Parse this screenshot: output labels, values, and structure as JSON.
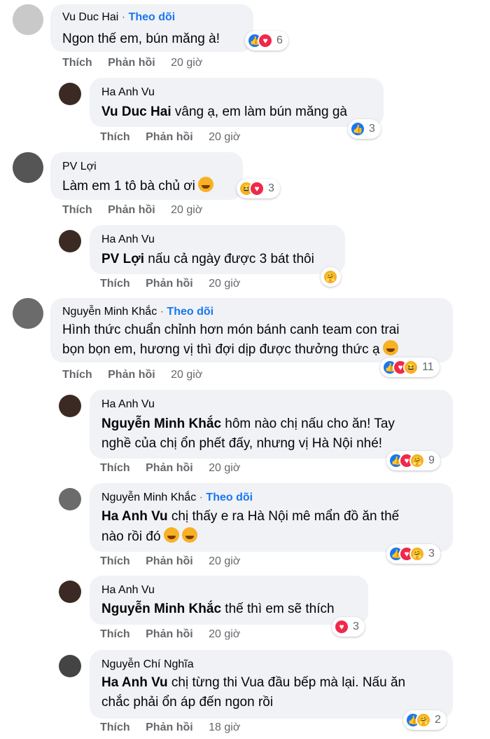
{
  "comments": [
    {
      "name": "Vu Duc Hai",
      "follow": "Theo dõi",
      "text": "Ngon thế em, bún măng à!",
      "actions": {
        "like": "Thích",
        "reply": "Phản hồi",
        "time": "20 giờ"
      },
      "reactions": {
        "icons": [
          "like-icon",
          "love-icon"
        ],
        "count": "6"
      }
    },
    {
      "name": "Ha Anh Vu",
      "mention": "Vu Duc Hai",
      "text": " vâng ạ, em làm bún măng gà",
      "actions": {
        "like": "Thích",
        "reply": "Phản hồi",
        "time": "20 giờ"
      },
      "reactions": {
        "icons": [
          "like-icon"
        ],
        "count": "3"
      }
    },
    {
      "name": "PV Lợi",
      "text": "Làm em 1 tô bà chủ ơi",
      "actions": {
        "like": "Thích",
        "reply": "Phản hồi",
        "time": "20 giờ"
      },
      "reactions": {
        "icons": [
          "haha-icon",
          "love-icon"
        ],
        "count": "3"
      }
    },
    {
      "name": "Ha Anh Vu",
      "mention": "PV Lợi",
      "text": " nấu cả ngày được 3 bát thôi",
      "actions": {
        "like": "Thích",
        "reply": "Phản hồi",
        "time": "20 giờ"
      },
      "reactions": {
        "icons": [
          "care-icon"
        ],
        "count": ""
      }
    },
    {
      "name": "Nguyễn Minh Khắc",
      "follow": "Theo dõi",
      "text_lines": [
        "Hình thức chuẩn chỉnh hơn món bánh canh team con trai",
        "bọn bọn em, hương vị thì đợi dịp được thưởng thức ạ"
      ],
      "actions": {
        "like": "Thích",
        "reply": "Phản hồi",
        "time": "20 giờ"
      },
      "reactions": {
        "icons": [
          "like-icon",
          "love-icon",
          "haha-icon"
        ],
        "count": "11"
      }
    },
    {
      "name": "Ha Anh Vu",
      "mention": "Nguyễn Minh Khắc",
      "text_lines": [
        " hôm nào chị nấu cho ăn! Tay",
        "nghề của chị ổn phết đấy, nhưng vị Hà Nội nhé!"
      ],
      "actions": {
        "like": "Thích",
        "reply": "Phản hồi",
        "time": "20 giờ"
      },
      "reactions": {
        "icons": [
          "like-icon",
          "love-icon",
          "care-icon"
        ],
        "count": "9"
      }
    },
    {
      "name": "Nguyễn Minh Khắc",
      "follow": "Theo dõi",
      "mention": "Ha Anh Vu",
      "text_lines": [
        " chị thấy e ra Hà Nội mê mẩn đồ ăn thế",
        "nào rồi đó"
      ],
      "actions": {
        "like": "Thích",
        "reply": "Phản hồi",
        "time": "20 giờ"
      },
      "reactions": {
        "icons": [
          "like-icon",
          "love-icon",
          "care-icon"
        ],
        "count": "3"
      }
    },
    {
      "name": "Ha Anh Vu",
      "mention": "Nguyễn Minh Khắc",
      "text": " thế thì em sẽ thích",
      "actions": {
        "like": "Thích",
        "reply": "Phản hồi",
        "time": "20 giờ"
      },
      "reactions": {
        "icons": [
          "love-icon"
        ],
        "count": "3"
      }
    },
    {
      "name": "Nguyễn Chí Nghĩa",
      "mention": "Ha Anh Vu",
      "text_lines": [
        " chị từng thi Vua đầu bếp mà lại. Nấu ăn",
        "chắc phải ổn áp đến ngon rồi"
      ],
      "actions": {
        "like": "Thích",
        "reply": "Phản hồi",
        "time": "18 giờ"
      },
      "reactions": {
        "icons": [
          "like-icon",
          "care-icon"
        ],
        "count": "2"
      }
    }
  ],
  "separator": "·",
  "colors": {
    "bubble": "#f0f2f5",
    "link": "#1877f2",
    "meta": "#65676b",
    "like": "#1877f2",
    "love": "#f02849",
    "haha": "#f7b125"
  }
}
